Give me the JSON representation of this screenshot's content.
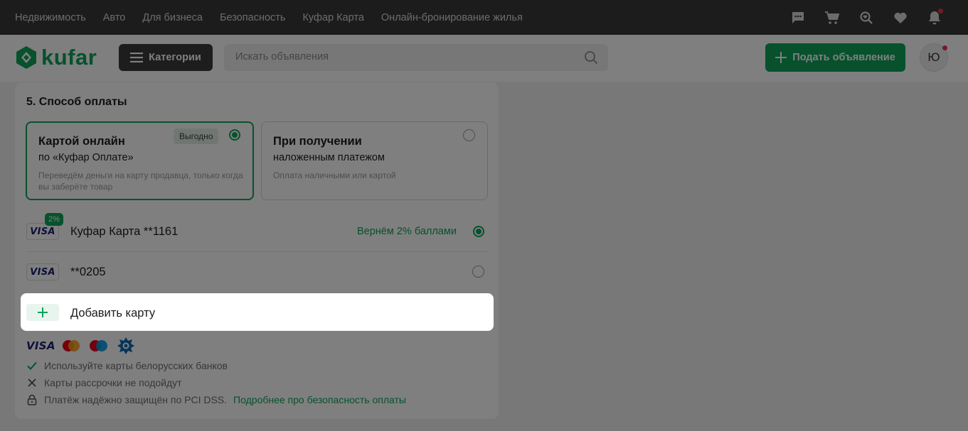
{
  "topbar": {
    "links": [
      "Недвижимость",
      "Авто",
      "Для бизнеса",
      "Безопасность",
      "Куфар Карта",
      "Онлайн-бронирование жилья"
    ],
    "icons": [
      "chat-icon",
      "cart-icon",
      "saved-search-icon",
      "favorites-heart-icon",
      "notifications-bell-icon"
    ]
  },
  "header": {
    "logo_text": "kufar",
    "categories_label": "Категории",
    "search_placeholder": "Искать объявления",
    "post_ad_label": "Подать объявление",
    "avatar_letter": "Ю"
  },
  "payment": {
    "section_title": "5. Способ оплаты",
    "options": [
      {
        "title": "Картой онлайн",
        "subtitle": "по «Куфар Оплате»",
        "description": "Переведём деньги на карту продавца, только когда вы заберёте товар",
        "badge": "Выгодно",
        "selected": true
      },
      {
        "title": "При получении",
        "subtitle": "наложенным платежом",
        "description": "Оплата наличными или картой",
        "selected": false
      }
    ],
    "cards": [
      {
        "brand": "VISA",
        "badge": "2%",
        "label": "Куфар Карта **1161",
        "cashback": "Вернём 2% баллами",
        "selected": true
      },
      {
        "brand": "VISA",
        "label": "**0205",
        "selected": false
      }
    ],
    "add_card": {
      "icon": "+",
      "label": "Добавить карту"
    },
    "accepted_brands": [
      "VISA",
      "mastercard-icon",
      "maestro-icon",
      "belkart-icon"
    ],
    "notes": [
      {
        "icon": "check-icon",
        "text": "Используйте карты белорусских банков"
      },
      {
        "icon": "cross-icon",
        "text": "Карты рассрочки не подойдут"
      },
      {
        "icon": "lock-icon",
        "text": "Платёж надёжно защищён по PCI DSS.",
        "link": "Подробнее про безопасность оплаты"
      }
    ]
  },
  "colors": {
    "brand_green": "#0ea35a",
    "topbar_bg": "#383838",
    "overlay": "rgba(0,0,0,0.5)",
    "notification_red": "#e9344a"
  }
}
